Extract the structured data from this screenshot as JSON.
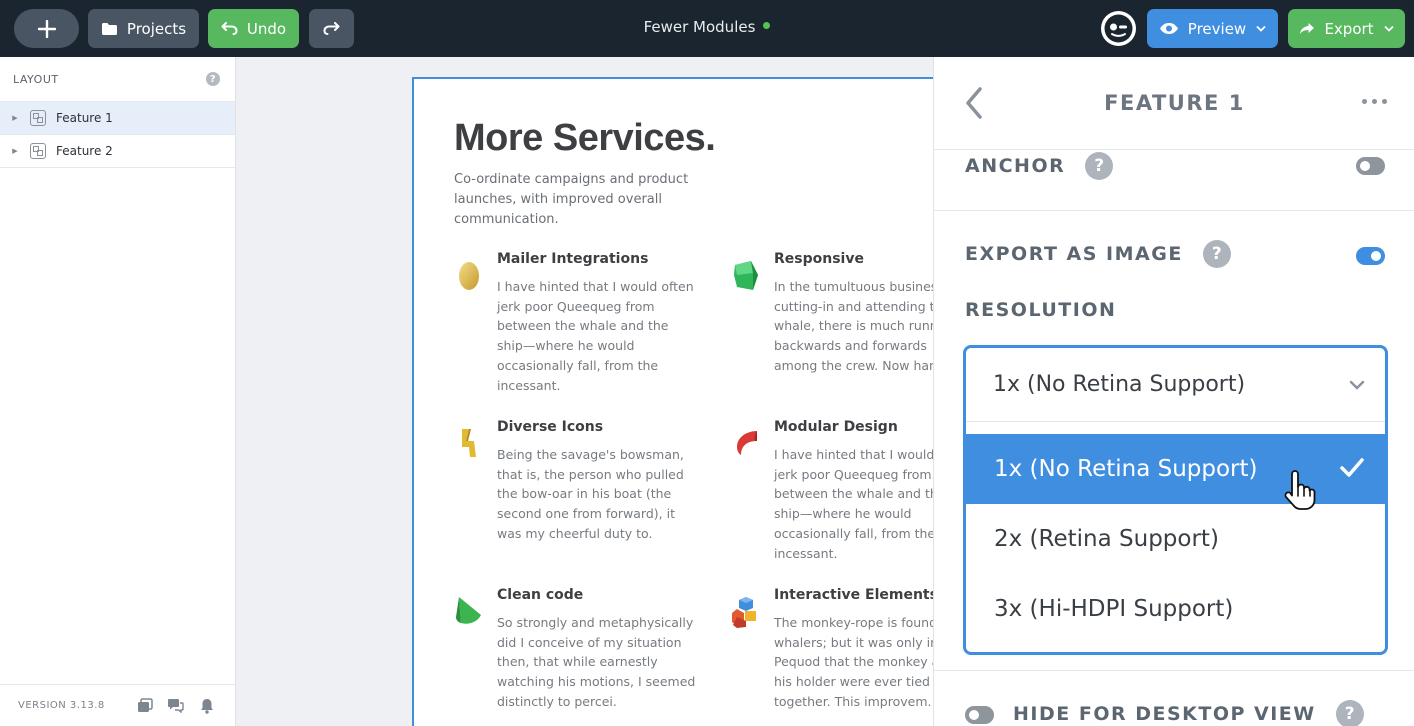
{
  "topbar": {
    "projects_label": "Projects",
    "undo_label": "Undo",
    "document_title": "Fewer Modules",
    "preview_label": "Preview",
    "export_label": "Export",
    "colors": {
      "background": "#1b2530",
      "green": "#57b85f",
      "blue": "#3f8ee0",
      "status": "#57c24f"
    }
  },
  "sidebar": {
    "header": "LAYOUT",
    "help": "?",
    "items": [
      {
        "label": "Feature 1",
        "active": true
      },
      {
        "label": "Feature 2",
        "active": false
      }
    ],
    "version": "VERSION 3.13.8"
  },
  "canvas": {
    "heading": "More Services.",
    "subheading": "Co-ordinate campaigns and product launches, with improved overall communication.",
    "features": [
      {
        "icon": "egg-icon",
        "title": "Mailer Integrations",
        "text": "I have hinted that I would often jerk poor Queequeg from between the whale and the ship—where he would occasionally fall, from the incessant."
      },
      {
        "icon": "cube-icon",
        "title": "Responsive",
        "text": "In the tumultuous business of cutting-in and attending to a whale, there is much running backwards and forwards among the crew. Now hand"
      },
      {
        "icon": "bolt-icon",
        "title": "Diverse Icons",
        "text": "Being the savage's bowsman, that is, the person who pulled the bow-oar in his boat (the second one from forward), it was my cheerful duty to."
      },
      {
        "icon": "curve-icon",
        "title": "Modular Design",
        "text": "I have hinted that I would often jerk poor Queequeg from between the whale and the ship—where he would occasionally fall, from the incessant."
      },
      {
        "icon": "cone-icon",
        "title": "Clean code",
        "text": "So strongly and metaphysically did I conceive of my situation then, that while earnestly watching his motions, I seemed distinctly to percei."
      },
      {
        "icon": "blocks-icon",
        "title": "Interactive Elements",
        "text": "The monkey-rope is found in all whalers; but it was only in the Pequod that the monkey and his holder were ever tied together. This improvem."
      }
    ]
  },
  "panel": {
    "title": "FEATURE 1",
    "anchor_label": "ANCHOR",
    "anchor_on": false,
    "export_image_label": "EXPORT AS IMAGE",
    "export_image_on": true,
    "resolution_label": "RESOLUTION",
    "resolution_selected": "1x (No Retina Support)",
    "resolution_options": [
      {
        "label": "1x (No Retina Support)",
        "selected": true
      },
      {
        "label": "2x (Retina Support)",
        "selected": false
      },
      {
        "label": "3x (Hi-HDPI Support)",
        "selected": false
      }
    ],
    "hide_desktop_label": "HIDE FOR DESKTOP VIEW",
    "hide_desktop_on": false,
    "help": "?"
  }
}
